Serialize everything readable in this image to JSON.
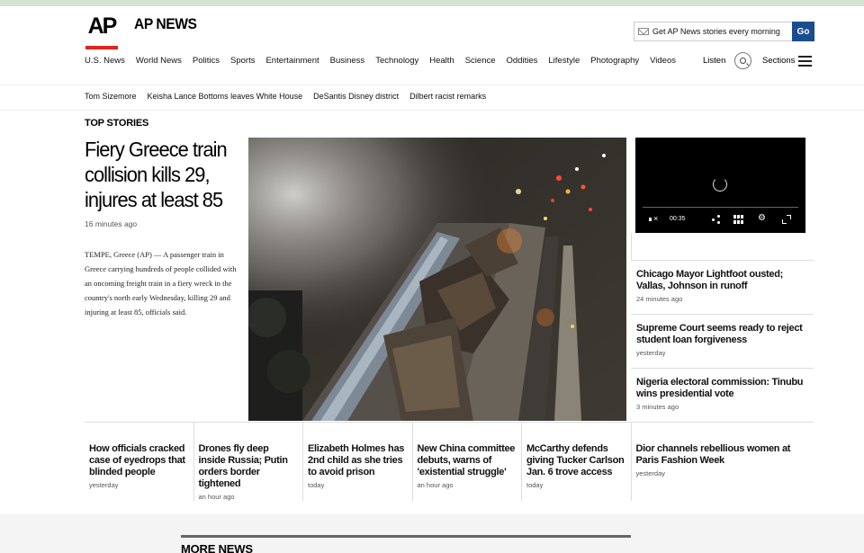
{
  "brand": {
    "logo_text": "AP",
    "name": "AP NEWS"
  },
  "subscribe": {
    "placeholder": "Get AP News stories every morning",
    "button": "Go"
  },
  "nav": {
    "items": [
      "U.S. News",
      "World News",
      "Politics",
      "Sports",
      "Entertainment",
      "Business",
      "Technology",
      "Health",
      "Science",
      "Oddities",
      "Lifestyle",
      "Photography",
      "Videos"
    ],
    "listen": "Listen",
    "sections": "Sections"
  },
  "trending": [
    "Tom Sizemore",
    "Keisha Lance Bottoms leaves White House",
    "DeSantis Disney district",
    "Dilbert racist remarks"
  ],
  "top_stories_label": "TOP STORIES",
  "lead": {
    "headline": "Fiery Greece train collision kills 29, injures at least 85",
    "time": "16 minutes ago",
    "body": "TEMPE, Greece (AP) — A passenger train in Greece carrying hundreds of people collided with an oncoming freight train in a fiery wreck in the country's north early Wednesday, killing 29 and injuring at least 85, officials said."
  },
  "video": {
    "time": "00:35"
  },
  "side_stories": [
    {
      "headline": "Chicago Mayor Lightfoot ousted; Vallas, Johnson in runoff",
      "time": "24 minutes ago"
    },
    {
      "headline": "Supreme Court seems ready to reject student loan forgiveness",
      "time": "yesterday"
    },
    {
      "headline": "Nigeria electoral commission: Tinubu wins presidential vote",
      "time": "3 minutes ago"
    }
  ],
  "bottom_stories": [
    {
      "headline": "How officials cracked case of eyedrops that blinded people",
      "time": "yesterday"
    },
    {
      "headline": "Drones fly deep inside Russia; Putin orders border tightened",
      "time": "an hour ago"
    },
    {
      "headline": "Elizabeth Holmes has 2nd child as she tries to avoid prison",
      "time": "today"
    },
    {
      "headline": "New China committee debuts, warns of 'existential struggle'",
      "time": "an hour ago"
    },
    {
      "headline": "McCarthy defends giving Tucker Carlson Jan. 6 trove access",
      "time": "today"
    },
    {
      "headline": "Dior channels rebellious women at Paris Fashion Week",
      "time": "yesterday"
    }
  ],
  "more_news_label": "MORE NEWS",
  "colors": {
    "accent_red": "#e2231a",
    "go_blue": "#1a4d8f"
  }
}
